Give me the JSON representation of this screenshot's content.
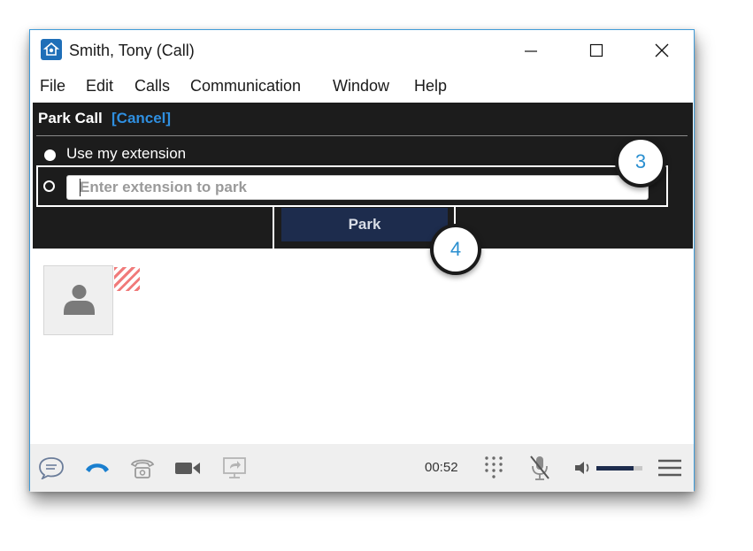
{
  "window": {
    "title": "Smith, Tony (Call)"
  },
  "menu": [
    "File",
    "Edit",
    "Calls",
    "Communication",
    "Window",
    "Help"
  ],
  "park": {
    "title": "Park Call",
    "cancel": "[Cancel]",
    "option_own": "Use my extension",
    "placeholder": "Enter extension to park",
    "button": "Park"
  },
  "callouts": [
    "3",
    "4"
  ],
  "call": {
    "timer": "00:52",
    "volume_level": 0.8
  },
  "icons": [
    "app-icon",
    "minimize-icon",
    "maximize-icon",
    "close-icon",
    "avatar-person-icon",
    "chat-icon",
    "hangup-icon",
    "phone-icon",
    "video-icon",
    "screen-share-icon",
    "dialpad-icon",
    "mute-mic-icon",
    "volume-icon",
    "hamburger-menu-icon"
  ],
  "colors": {
    "window_border": "#3f9bd8",
    "panel_bg": "#1c1c1c",
    "cancel_link": "#2f8fe0",
    "park_button": "#1d2c4d",
    "hangup": "#1a7fcf",
    "callout_number": "#2a8fd0"
  }
}
